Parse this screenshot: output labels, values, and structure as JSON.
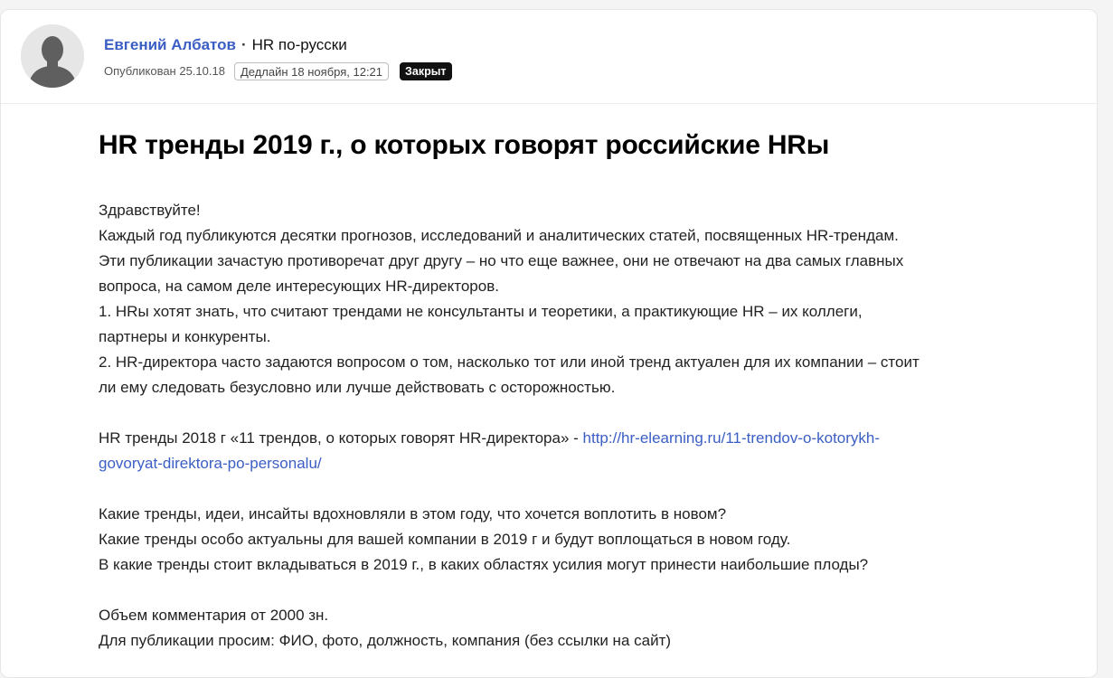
{
  "header": {
    "author_name": "Евгений Албатов",
    "separator": "·",
    "community": "HR по-русски",
    "published": "Опубликован 25.10.18",
    "deadline": "Дедлайн 18 ноября, 12:21",
    "status": "Закрыт",
    "avatar_icon": "user-silhouette-icon"
  },
  "post": {
    "title": "HR тренды 2019 г., о которых говорят российские HRы",
    "greeting": "Здравствуйте!",
    "para1_line1": "Каждый год публикуются десятки прогнозов, исследований и аналитических статей, посвященных HR-трендам.",
    "para1_line2": "Эти публикации зачастую противоречат друг другу – но что еще важнее, они не отвечают на два самых главных",
    "para1_line3": "вопроса, на самом деле интересующих HR-директоров.",
    "point1_line1": "1. HRы хотят знать, что считают трендами не консультанты и теоретики, а практикующие HR – их коллеги,",
    "point1_line2": "партнеры и конкуренты.",
    "point2_line1": "2. HR-директора часто задаются вопросом о том, насколько тот или иной тренд актуален для их компании – стоит",
    "point2_line2": "ли ему следовать безусловно или лучше действовать с осторожностью.",
    "ref_text": "HR тренды 2018 г «11 трендов, о которых говорят HR-директора» - ",
    "ref_link_part1": "http://hr-elearning.ru/11-trendov-o-kotorykh-",
    "ref_link_part2": "govoryat-direktora-po-personalu/",
    "q1": "Какие тренды, идеи, инсайты вдохновляли в этом году, что хочется воплотить в новом?",
    "q2": "Какие тренды особо актуальны для вашей компании в 2019 г и будут воплощаться в новом году.",
    "q3": "В какие тренды стоит вкладываться в 2019 г., в каких областях усилия могут принести наибольшие плоды?",
    "req1": "Объем комментария от 2000 зн.",
    "req2": "Для публикации просим: ФИО, фото, должность, компания (без ссылки на сайт)"
  },
  "colors": {
    "accent": "#3b5ec4",
    "status_bg": "#111111"
  }
}
